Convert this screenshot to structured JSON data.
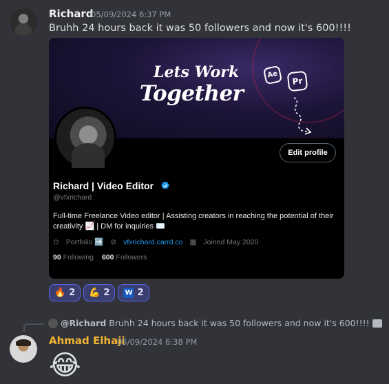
{
  "messages": [
    {
      "author": "Richard",
      "timestamp": "05/09/2024 6:37 PM",
      "author_color": "#f2f3f5",
      "text": "Bruhh 24 hours back it was 50 followers and now it's 600!!!!",
      "embed": {
        "banner_line1": "Lets Work",
        "banner_line2": "Together",
        "banner_icon_ae": "Ae",
        "banner_icon_pr": "Pr",
        "edit_button": "Edit profile",
        "display_name": "Richard | Video Editor",
        "handle": "@vfxrichard",
        "bio": "Full-time Freelance Video editor | Assisting creators in reaching the potential of their creativity 📈 | DM for inquiries ✉️",
        "portfolio_label": "Portfolio ➡️",
        "link": "vfxrichard.carrd.co",
        "joined": "Joined May 2020",
        "following_count": "90",
        "following_label": "Following",
        "followers_count": "600",
        "followers_label": "Followers"
      },
      "reactions": [
        {
          "emoji": "🔥",
          "count": "2"
        },
        {
          "emoji": "💪",
          "count": "2"
        },
        {
          "emoji": "W",
          "count": "2"
        }
      ]
    },
    {
      "reply_to_mention": "@Richard",
      "reply_to_text": "Bruhh 24 hours back it was 50 followers and now it's 600!!!!",
      "author": "Ahmad Elhaji",
      "author_color": "#f0b232",
      "timestamp": "05/09/2024 6:38 PM",
      "emoji": "😂"
    }
  ],
  "colors": {
    "background": "#323339",
    "verified": "#1d9bf0",
    "reaction_border": "#5865f2"
  }
}
